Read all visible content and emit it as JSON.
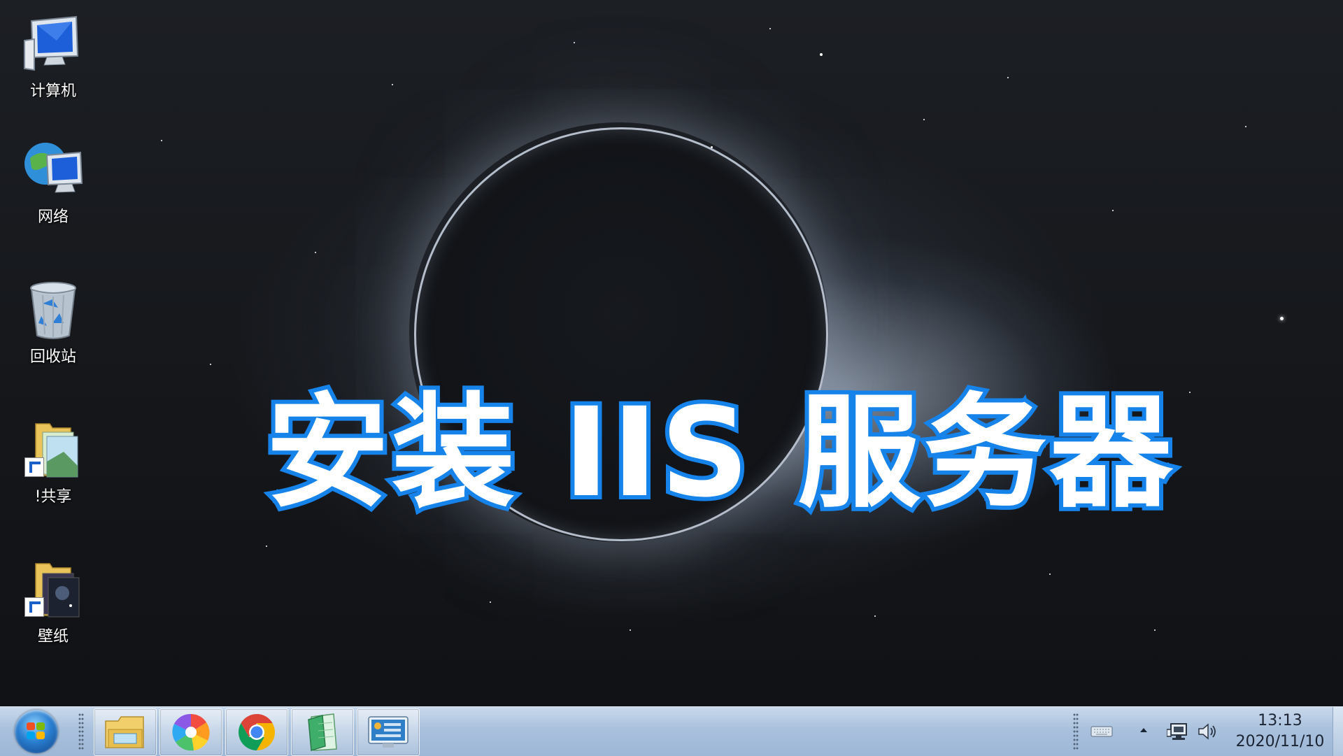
{
  "desktop": {
    "icons": [
      {
        "label": "计算机",
        "icon": "computer-icon"
      },
      {
        "label": "网络",
        "icon": "network-icon"
      },
      {
        "label": "回收站",
        "icon": "recycle-bin-icon"
      },
      {
        "label": "!共享",
        "icon": "shared-folder-shortcut-icon"
      },
      {
        "label": "壁纸",
        "icon": "wallpaper-folder-shortcut-icon"
      }
    ]
  },
  "overlay": {
    "title": "安装 IIS 服务器",
    "text_color": "#ffffff",
    "outline_color": "#1683ea"
  },
  "taskbar": {
    "start": {
      "icon": "windows-start-orb"
    },
    "pinned": [
      {
        "icon": "file-explorer-icon"
      },
      {
        "icon": "pinwheel-app-icon"
      },
      {
        "icon": "chrome-icon"
      },
      {
        "icon": "notepad-app-icon"
      },
      {
        "icon": "control-panel-app-icon"
      }
    ],
    "tray": {
      "icons": [
        "keyboard-icon",
        "show-hidden-icons-arrow",
        "network-status-icon",
        "volume-icon"
      ],
      "time": "13:13",
      "date": "2020/11/10"
    }
  }
}
